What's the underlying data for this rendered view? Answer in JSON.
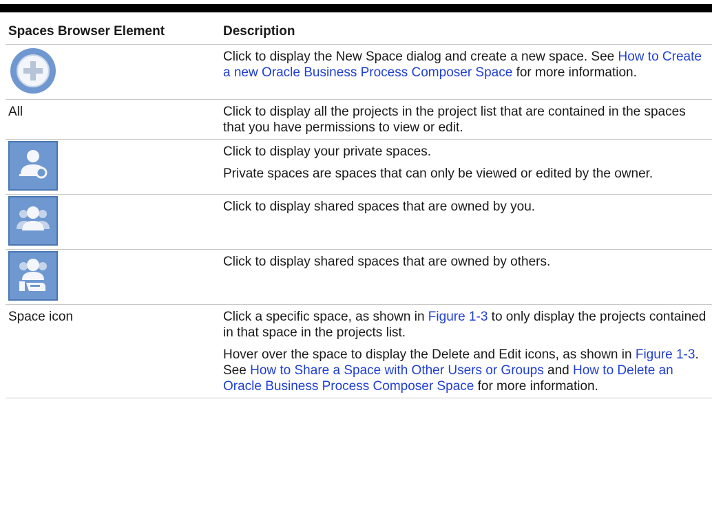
{
  "table": {
    "header": {
      "element": "Spaces Browser Element",
      "description": "Description"
    },
    "rows": [
      {
        "icon": "add-space-icon",
        "p1": {
          "t1": "Click to display the New Space dialog and create a new space.",
          "t2": "See ",
          "link1": "How to Create a new Oracle Business Process Composer Space",
          "t3": " for more information."
        }
      },
      {
        "label": "All",
        "p1": "Click to display all the projects in the project list that are contained in the spaces that you have permissions to view or edit."
      },
      {
        "icon": "private-space-icon",
        "p1": "Click to display your private spaces.",
        "p2": "Private spaces are spaces that can only be viewed or edited by the owner."
      },
      {
        "icon": "shared-by-me-icon",
        "p1": "Click to display shared spaces that are owned by you."
      },
      {
        "icon": "shared-by-others-icon",
        "p1": "Click to display shared spaces that are owned by others."
      },
      {
        "label": "Space icon",
        "p1": {
          "t1": "Click a specific space, as shown in ",
          "link1": "Figure 1-3",
          "t2": " to only display the projects contained in that space in the projects list."
        },
        "p2": {
          "t1": "Hover over the space to display the Delete and Edit icons, as shown in ",
          "link1": "Figure 1-3",
          "t2": ". See ",
          "link2": "How to Share a Space with Other Users or Groups",
          "t3": " and ",
          "link3": "How to Delete an Oracle Business Process Composer Space",
          "t4": " for more information."
        }
      }
    ]
  },
  "colors": {
    "link": "#1f3fd4",
    "icon_fill": "#6f98d0",
    "icon_border": "#4a76b4",
    "rule": "#000000"
  }
}
